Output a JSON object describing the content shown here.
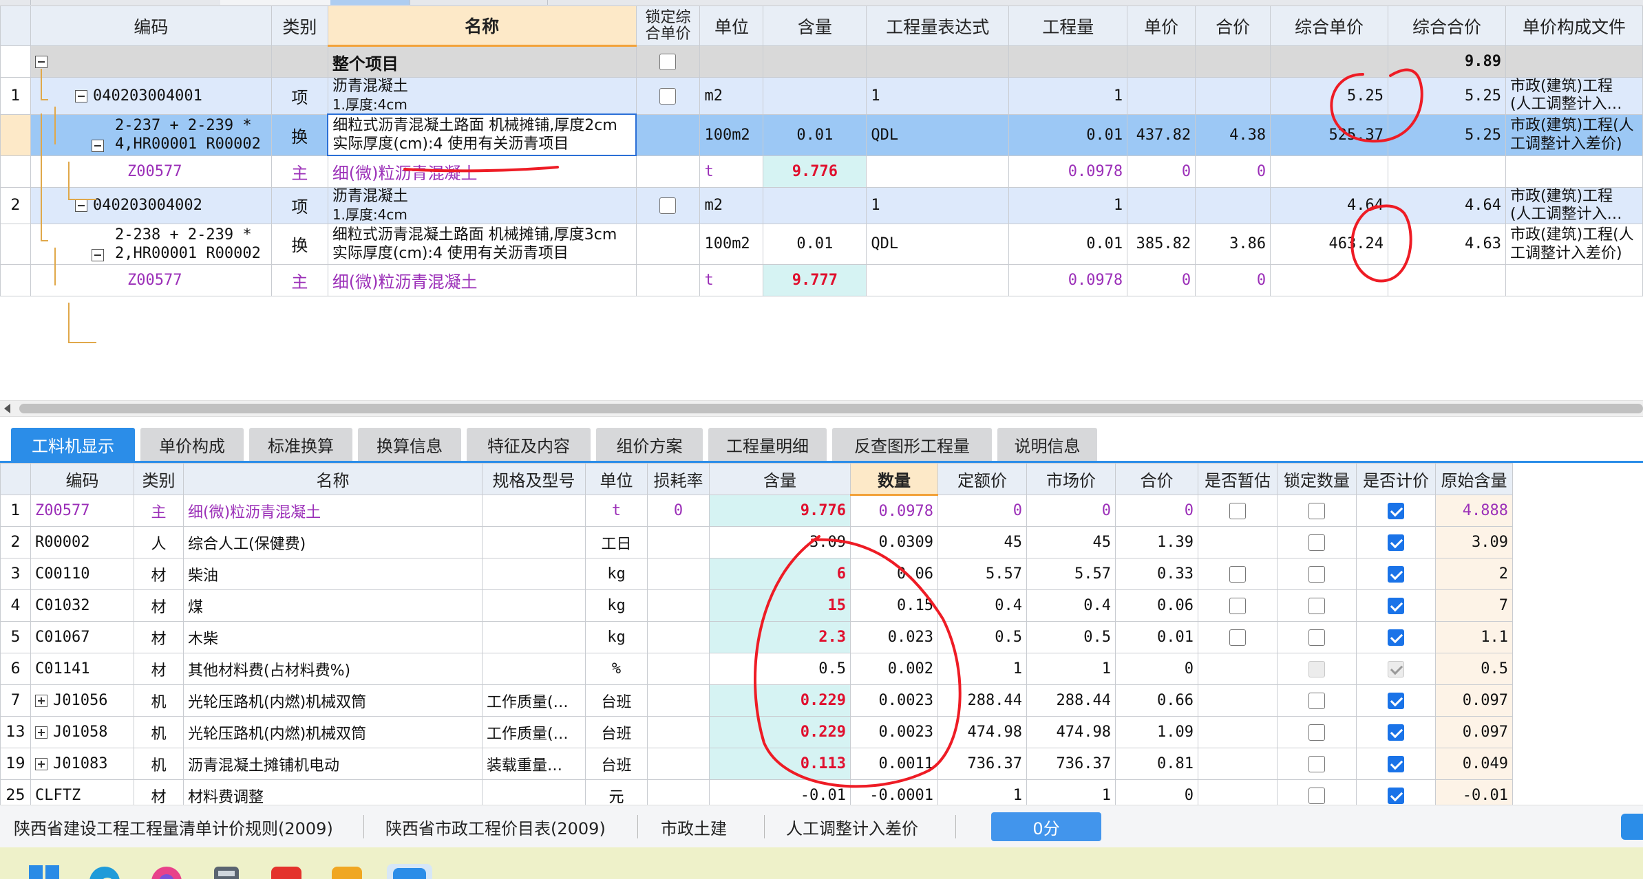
{
  "top_grid": {
    "headers": {
      "code": "编码",
      "type": "类别",
      "name": "名称",
      "lock": "锁定综合单价",
      "unit": "单位",
      "content": "含量",
      "expr": "工程量表达式",
      "qty": "工程量",
      "price": "单价",
      "total": "合价",
      "comp_price": "综合单价",
      "comp_total": "综合合价",
      "file": "单价构成文件"
    },
    "project_row": {
      "name": "整个项目",
      "comp_total": "9.89"
    },
    "rows": [
      {
        "index": "1",
        "code": "040203004001",
        "type": "项",
        "name_l1": "沥青混凝土",
        "name_l2": "1.厚度:4cm",
        "unit": "m2",
        "expr": "1",
        "qty": "1",
        "comp_price": "5.25",
        "comp_total": "5.25",
        "file_l1": "市政(建筑)工程",
        "file_l2": "(人工调整计入…"
      },
      {
        "code_l1": "2-237 + 2-239 *",
        "code_l2": "4,HR00001 R00002",
        "type": "换",
        "name": "细粒式沥青混凝土路面 机械摊铺,厚度2cm  实际厚度(cm):4  使用有关沥青项目",
        "unit": "100m2",
        "content": "0.01",
        "expr": "QDL",
        "qty": "0.01",
        "price": "437.82",
        "total": "4.38",
        "comp_price": "525.37",
        "comp_total": "5.25",
        "file": "市政(建筑)工程(人工调整计入差价)"
      },
      {
        "code": "Z00577",
        "type": "主",
        "name": "细(微)粒沥青混凝土",
        "unit": "t",
        "content": "9.776",
        "qty": "0.0978",
        "price": "0",
        "total": "0"
      },
      {
        "index": "2",
        "code": "040203004002",
        "type": "项",
        "name_l1": "沥青混凝土",
        "name_l2": "1.厚度:4cm",
        "unit": "m2",
        "expr": "1",
        "qty": "1",
        "comp_price": "4.64",
        "comp_total": "4.64",
        "file_l1": "市政(建筑)工程",
        "file_l2": "(人工调整计入…"
      },
      {
        "code_l1": "2-238 + 2-239 *",
        "code_l2": "2,HR00001 R00002",
        "type": "换",
        "name": "细粒式沥青混凝土路面 机械摊铺,厚度3cm  实际厚度(cm):4  使用有关沥青项目",
        "unit": "100m2",
        "content": "0.01",
        "expr": "QDL",
        "qty": "0.01",
        "price": "385.82",
        "total": "3.86",
        "comp_price": "463.24",
        "comp_total": "4.63",
        "file": "市政(建筑)工程(人工调整计入差价)"
      },
      {
        "code": "Z00577",
        "type": "主",
        "name": "细(微)粒沥青混凝土",
        "unit": "t",
        "content": "9.777",
        "qty": "0.0978",
        "price": "0",
        "total": "0"
      }
    ]
  },
  "tabs": [
    "工料机显示",
    "单价构成",
    "标准换算",
    "换算信息",
    "特征及内容",
    "组价方案",
    "工程量明细",
    "反查图形工程量",
    "说明信息"
  ],
  "bottom_grid": {
    "headers": [
      "编码",
      "类别",
      "名称",
      "规格及型号",
      "单位",
      "损耗率",
      "含量",
      "数量",
      "定额价",
      "市场价",
      "合价",
      "是否暂估",
      "锁定数量",
      "是否计价",
      "原始含量"
    ],
    "rows": [
      {
        "idx": "1",
        "code": "Z00577",
        "type": "主",
        "name": "细(微)粒沥青混凝土",
        "spec": "",
        "unit": "t",
        "loss": "0",
        "content": "9.776",
        "qty": "0.0978",
        "quota": "0",
        "market": "0",
        "total": "0",
        "orig": "4.888"
      },
      {
        "idx": "2",
        "code": "R00002",
        "type": "人",
        "name": "综合人工(保健费)",
        "spec": "",
        "unit": "工日",
        "loss": "",
        "content": "3.09",
        "qty": "0.0309",
        "quota": "45",
        "market": "45",
        "total": "1.39",
        "orig": "3.09"
      },
      {
        "idx": "3",
        "code": "C00110",
        "type": "材",
        "name": "柴油",
        "spec": "",
        "unit": "kg",
        "loss": "",
        "content": "6",
        "qty": "0.06",
        "quota": "5.57",
        "market": "5.57",
        "total": "0.33",
        "orig": "2"
      },
      {
        "idx": "4",
        "code": "C01032",
        "type": "材",
        "name": "煤",
        "spec": "",
        "unit": "kg",
        "loss": "",
        "content": "15",
        "qty": "0.15",
        "quota": "0.4",
        "market": "0.4",
        "total": "0.06",
        "orig": "7"
      },
      {
        "idx": "5",
        "code": "C01067",
        "type": "材",
        "name": "木柴",
        "spec": "",
        "unit": "kg",
        "loss": "",
        "content": "2.3",
        "qty": "0.023",
        "quota": "0.5",
        "market": "0.5",
        "total": "0.01",
        "orig": "1.1"
      },
      {
        "idx": "6",
        "code": "C01141",
        "type": "材",
        "name": "其他材料费(占材料费%)",
        "spec": "",
        "unit": "%",
        "loss": "",
        "content": "0.5",
        "qty": "0.002",
        "quota": "1",
        "market": "1",
        "total": "0",
        "orig": "0.5"
      },
      {
        "idx": "7",
        "code": "J01056",
        "type": "机",
        "name": "光轮压路机(内燃)机械双筒",
        "spec": "工作质量(…",
        "unit": "台班",
        "loss": "",
        "content": "0.229",
        "qty": "0.0023",
        "quota": "288.44",
        "market": "288.44",
        "total": "0.66",
        "orig": "0.097"
      },
      {
        "idx": "13",
        "code": "J01058",
        "type": "机",
        "name": "光轮压路机(内燃)机械双筒",
        "spec": "工作质量(…",
        "unit": "台班",
        "loss": "",
        "content": "0.229",
        "qty": "0.0023",
        "quota": "474.98",
        "market": "474.98",
        "total": "1.09",
        "orig": "0.097"
      },
      {
        "idx": "19",
        "code": "J01083",
        "type": "机",
        "name": "沥青混凝土摊铺机电动",
        "spec": "装载重量…",
        "unit": "台班",
        "loss": "",
        "content": "0.113",
        "qty": "0.0011",
        "quota": "736.37",
        "market": "736.37",
        "total": "0.81",
        "orig": "0.049"
      },
      {
        "idx": "25",
        "code": "CLFTZ",
        "type": "材",
        "name": "材料费调整",
        "spec": "",
        "unit": "元",
        "loss": "",
        "content": "-0.01",
        "qty": "-0.0001",
        "quota": "1",
        "market": "1",
        "total": "0",
        "orig": "-0.01"
      }
    ]
  },
  "statusbar": {
    "rule": "陕西省建设工程工程量清单计价规则(2009)",
    "price_table": "陕西省市政工程价目表(2009)",
    "discipline": "市政土建",
    "labor_adjust": "人工调整计入差价",
    "score": "0分"
  },
  "colors": {
    "accent": "#2b8de8",
    "purple_text": "#9b2fb8",
    "red_value": "#e0102e",
    "annotation": "#ee1c25"
  }
}
